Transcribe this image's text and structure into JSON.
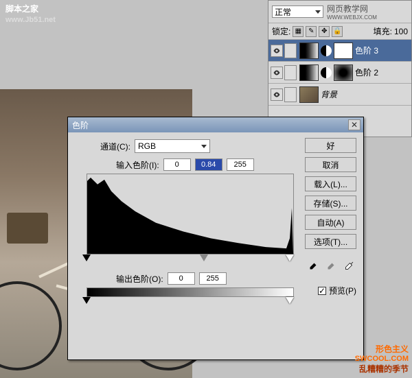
{
  "watermark": {
    "line1": "脚本之家",
    "line2": "www.Jb51.net"
  },
  "layers_panel": {
    "blend_mode": "正常",
    "logo_text": "网页教学网",
    "logo_url": "WWW.WEBJX.COM",
    "lock_label": "锁定:",
    "fill_label": "填充:",
    "fill_value": "100",
    "layers": [
      {
        "name": "色阶 3",
        "selected": true,
        "type": "adjustment",
        "mask": "white"
      },
      {
        "name": "色阶 2",
        "selected": false,
        "type": "adjustment",
        "mask": "grad"
      },
      {
        "name": "背景",
        "selected": false,
        "type": "image",
        "locked": true
      }
    ]
  },
  "dialog": {
    "title": "色阶",
    "channel_label": "通道(C):",
    "channel_value": "RGB",
    "input_label": "输入色阶(I):",
    "input_black": "0",
    "input_gamma": "0.84",
    "input_white": "255",
    "output_label": "输出色阶(O):",
    "output_black": "0",
    "output_white": "255",
    "buttons": {
      "ok": "好",
      "cancel": "取消",
      "load": "载入(L)...",
      "save": "存储(S)...",
      "auto": "自动(A)",
      "options": "选项(T)..."
    },
    "preview_label": "预览(P)",
    "preview_checked": true
  },
  "watermark2": {
    "line1": "形色主义",
    "line2": "SWCOOL.COM",
    "line3": "乱糟糟的季节"
  }
}
